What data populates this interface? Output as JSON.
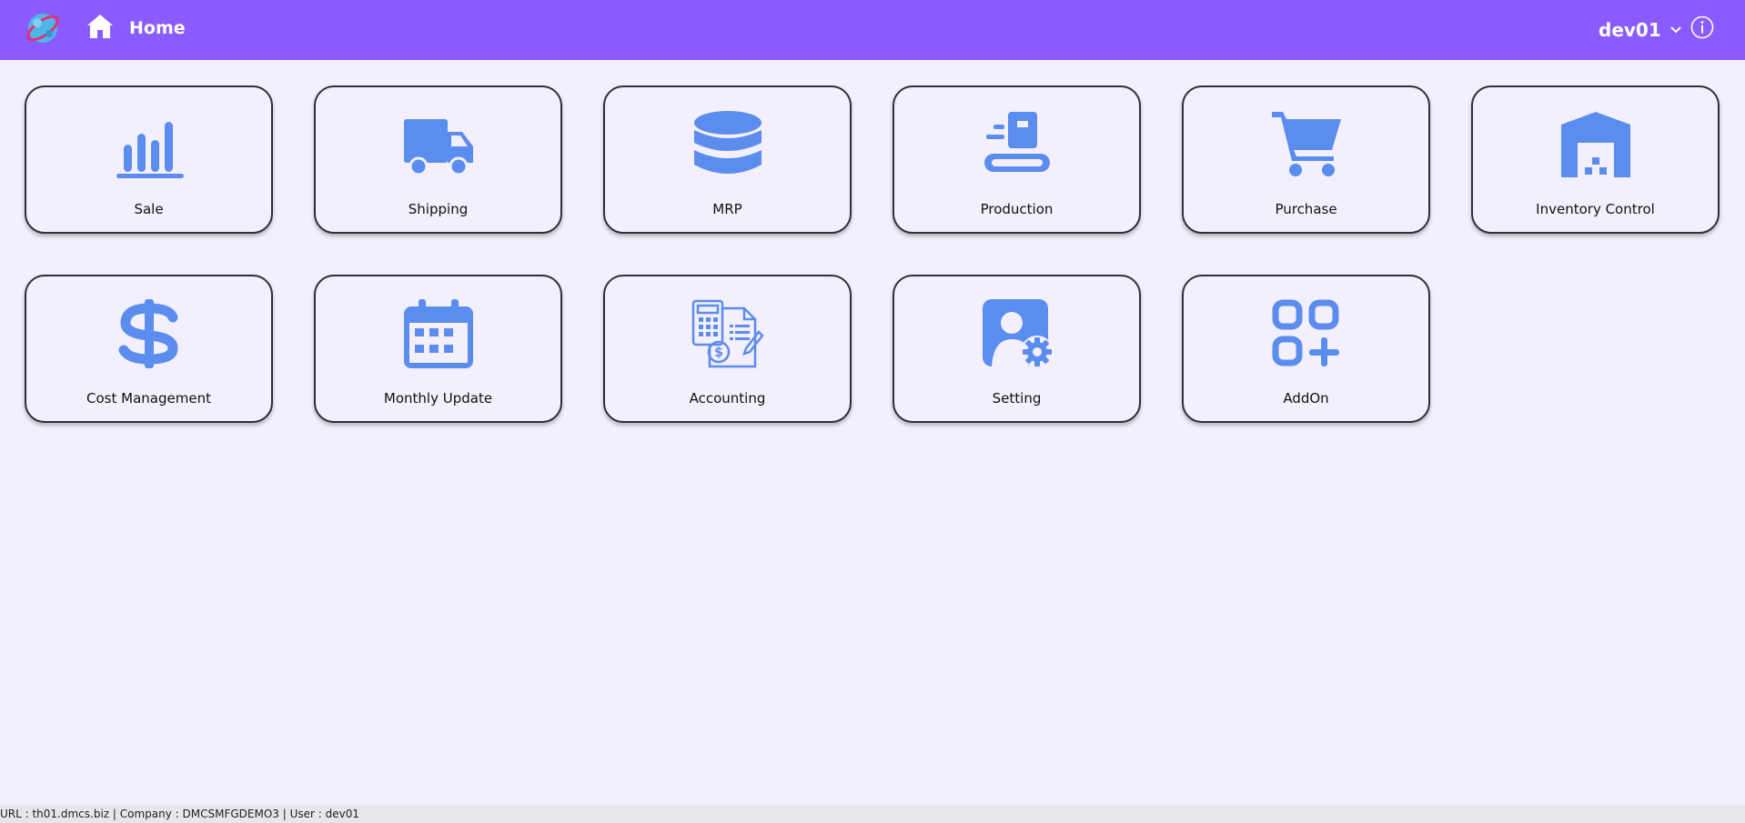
{
  "header": {
    "title": "Home",
    "user": "dev01"
  },
  "colors": {
    "topbar": "#8a5cff",
    "icon": "#5b8def",
    "background": "#f3effd"
  },
  "tiles": [
    {
      "label": "Sale",
      "icon": "bar-chart-icon"
    },
    {
      "label": "Shipping",
      "icon": "truck-icon"
    },
    {
      "label": "MRP",
      "icon": "database-icon"
    },
    {
      "label": "Production",
      "icon": "conveyor-icon"
    },
    {
      "label": "Purchase",
      "icon": "cart-icon"
    },
    {
      "label": "Inventory Control",
      "icon": "warehouse-icon"
    },
    {
      "label": "Cost Management",
      "icon": "dollar-icon"
    },
    {
      "label": "Monthly Update",
      "icon": "calendar-icon"
    },
    {
      "label": "Accounting",
      "icon": "accounting-icon"
    },
    {
      "label": "Setting",
      "icon": "user-settings-icon"
    },
    {
      "label": "AddOn",
      "icon": "apps-add-icon"
    }
  ],
  "status": {
    "text": "URL : th01.dmcs.biz | Company : DMCSMFGDEMO3 | User : dev01"
  }
}
